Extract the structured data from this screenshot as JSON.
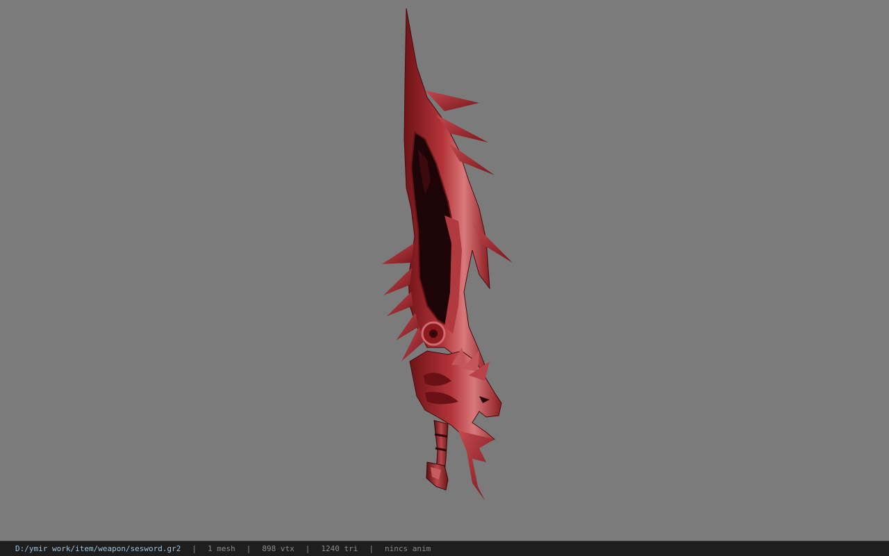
{
  "viewport": {
    "background": "#7b7b7b",
    "model_name": "sesword"
  },
  "status_bar": {
    "file_path": "D:/ymir work/item/weapon/sesword.gr2",
    "separator": "|",
    "mesh_count": "1 mesh",
    "vertex_count": "898 vtx",
    "triangle_count": "1240 tri",
    "animation": "nincs anim"
  },
  "colors": {
    "blade": "#a8262b",
    "blade_highlight": "#d9787a",
    "blade_shadow": "#5a0c10",
    "groove": "#1a0406",
    "statusbar_bg": "#1e1e1e",
    "path_text": "#9fc4dc",
    "info_text": "#8c8c8c"
  }
}
